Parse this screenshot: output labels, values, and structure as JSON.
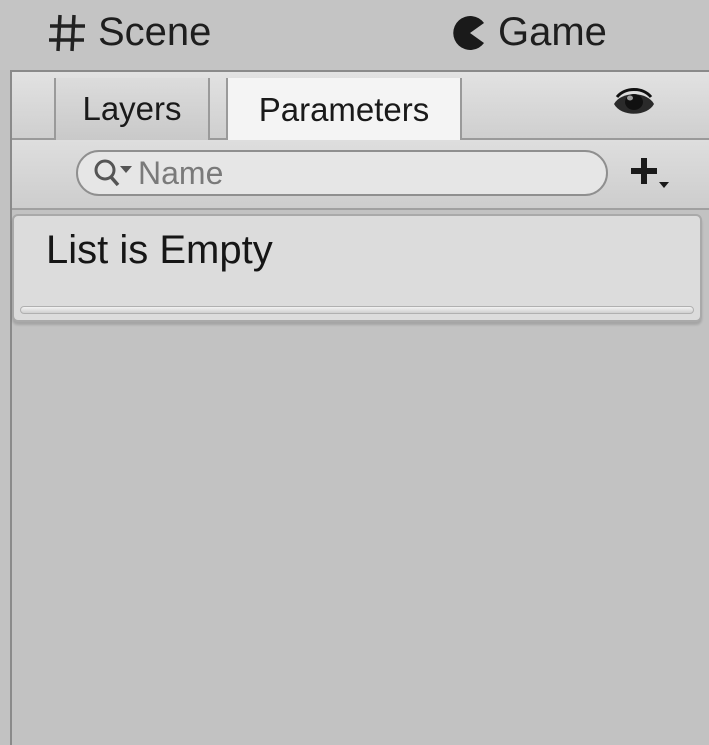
{
  "window_tabs": {
    "scene_label": "Scene",
    "game_label": "Game"
  },
  "toolbar": {
    "tabs": [
      {
        "label": "Layers",
        "active": false
      },
      {
        "label": "Parameters",
        "active": true
      }
    ],
    "eye_icon": "eye-icon"
  },
  "search": {
    "placeholder": "Name",
    "value": "",
    "icon": "search-icon",
    "add_icon": "plus-dropdown-icon"
  },
  "list": {
    "empty_text": "List is Empty"
  },
  "colors": {
    "background": "#c2c2c2",
    "active_tab": "#f4f4f4",
    "list_bg": "#dcdcdc"
  }
}
